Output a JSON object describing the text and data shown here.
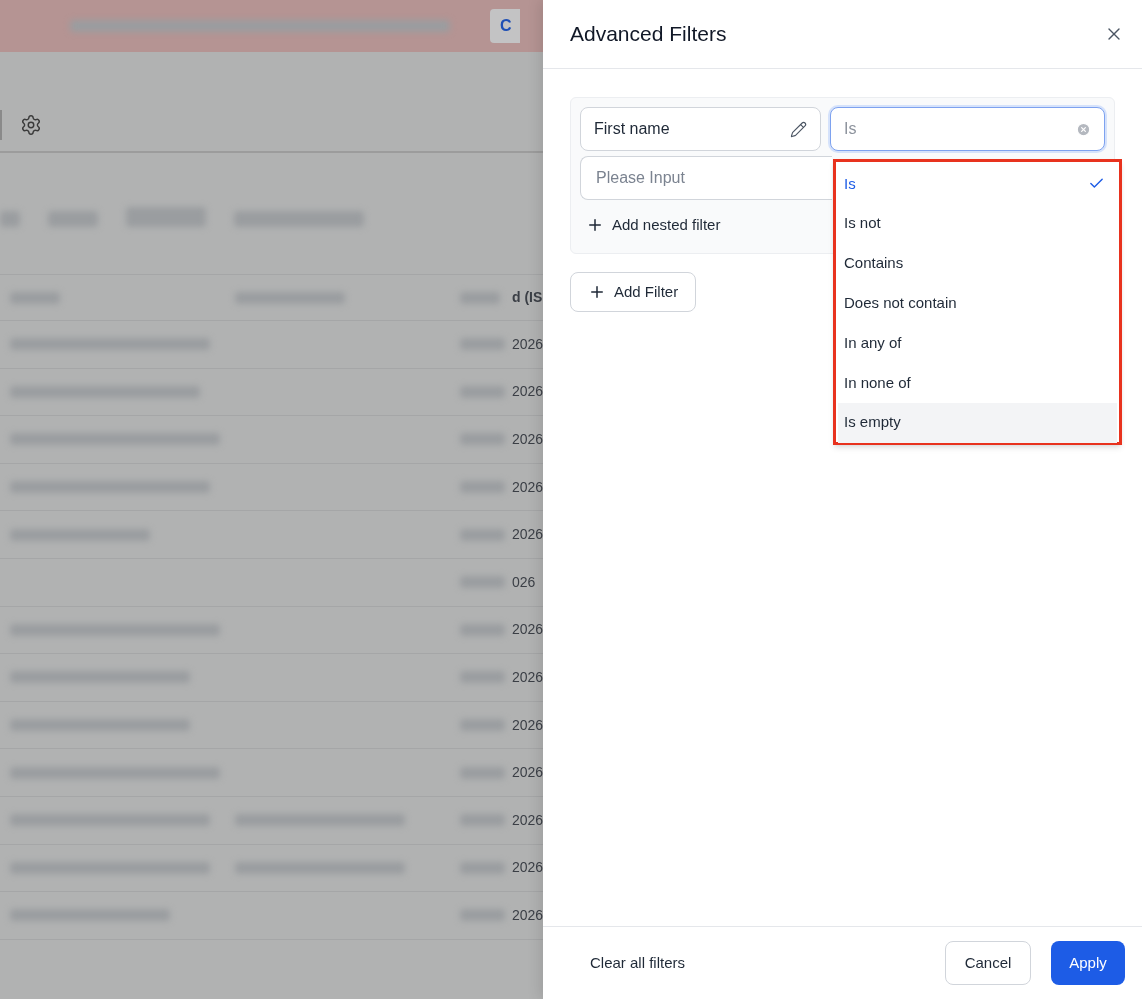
{
  "banner": {
    "button_label": "C"
  },
  "table": {
    "column_heading": "d (IS",
    "rows": [
      {
        "date": "2026"
      },
      {
        "date": "2026"
      },
      {
        "date": "2026"
      },
      {
        "date": "2026"
      },
      {
        "date": "2026"
      },
      {
        "date": "026"
      },
      {
        "date": "2026"
      },
      {
        "date": "2026"
      },
      {
        "date": "2026"
      },
      {
        "date": "2026"
      },
      {
        "date": "2026"
      },
      {
        "date": "2026"
      },
      {
        "date": "2026"
      }
    ]
  },
  "drawer": {
    "title": "Advanced Filters",
    "filter": {
      "field": "First name",
      "operator_placeholder": "Is",
      "value_placeholder": "Please Input",
      "add_nested": "Add nested filter"
    },
    "add_filter": "Add Filter",
    "operator_options": [
      {
        "label": "Is",
        "selected": true,
        "highlighted": false
      },
      {
        "label": "Is not",
        "selected": false,
        "highlighted": false
      },
      {
        "label": "Contains",
        "selected": false,
        "highlighted": false
      },
      {
        "label": "Does not contain",
        "selected": false,
        "highlighted": false
      },
      {
        "label": "In any of",
        "selected": false,
        "highlighted": false
      },
      {
        "label": "In none of",
        "selected": false,
        "highlighted": false
      },
      {
        "label": "Is empty",
        "selected": false,
        "highlighted": true
      }
    ],
    "footer": {
      "clear": "Clear all filters",
      "cancel": "Cancel",
      "apply": "Apply"
    }
  }
}
